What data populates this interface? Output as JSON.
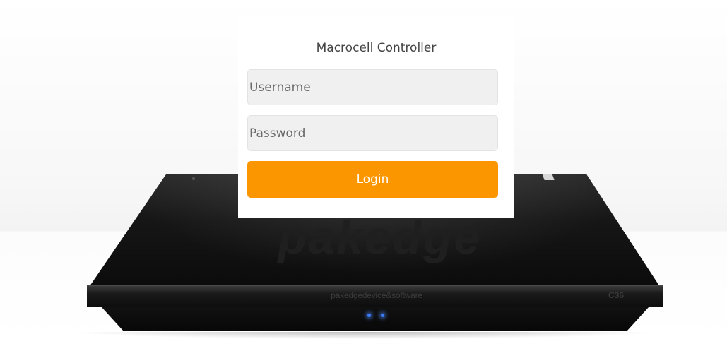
{
  "login": {
    "title": "Macrocell Controller",
    "username_placeholder": "Username",
    "username_value": "",
    "password_placeholder": "Password",
    "password_value": "",
    "button_label": "Login"
  },
  "device": {
    "watermark": "pakedge",
    "brand_label": "pakedgedevice&software",
    "model_label": "C36"
  },
  "colors": {
    "accent": "#fb9600",
    "card_background": "#ffffff",
    "field_background": "#f0f0f0",
    "device_body": "#111111",
    "led": "#3a7dff"
  }
}
